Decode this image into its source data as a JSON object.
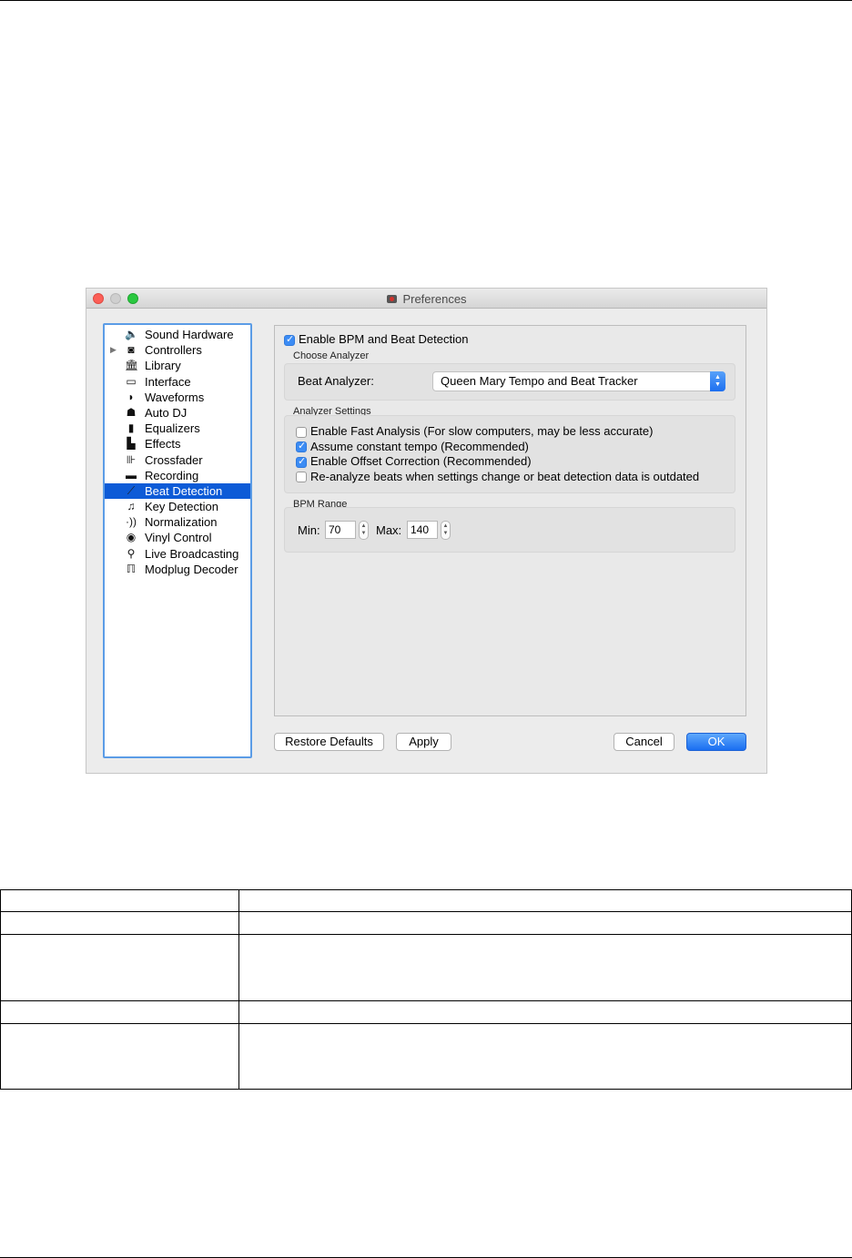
{
  "window": {
    "title": "Preferences"
  },
  "sidebar": {
    "items": [
      {
        "label": "Sound Hardware",
        "icon": "speaker-icon",
        "glyph": "🔈"
      },
      {
        "label": "Controllers",
        "icon": "controller-icon",
        "glyph": "◙"
      },
      {
        "label": "Library",
        "icon": "library-icon",
        "glyph": "🏛"
      },
      {
        "label": "Interface",
        "icon": "monitor-icon",
        "glyph": "▭"
      },
      {
        "label": "Waveforms",
        "icon": "waveforms-icon",
        "glyph": "◗"
      },
      {
        "label": "Auto DJ",
        "icon": "robot-icon",
        "glyph": "☗"
      },
      {
        "label": "Equalizers",
        "icon": "equalizer-icon",
        "glyph": "▮"
      },
      {
        "label": "Effects",
        "icon": "effects-icon",
        "glyph": "▙"
      },
      {
        "label": "Crossfader",
        "icon": "crossfader-icon",
        "glyph": "⊪"
      },
      {
        "label": "Recording",
        "icon": "recording-icon",
        "glyph": "▬"
      },
      {
        "label": "Beat Detection",
        "icon": "beat-detection-icon",
        "glyph": "⟋"
      },
      {
        "label": "Key Detection",
        "icon": "treble-clef-icon",
        "glyph": "♫"
      },
      {
        "label": "Normalization",
        "icon": "normalization-icon",
        "glyph": "·))"
      },
      {
        "label": "Vinyl Control",
        "icon": "vinyl-icon",
        "glyph": "◉"
      },
      {
        "label": "Live Broadcasting",
        "icon": "satellite-dish-icon",
        "glyph": "⚲"
      },
      {
        "label": "Modplug Decoder",
        "icon": "modplug-icon",
        "glyph": "ℿ"
      }
    ],
    "expandable_glyph": "▶",
    "selected": "Beat Detection"
  },
  "panel": {
    "enable_label": "Enable BPM and Beat Detection",
    "enable_checked": true,
    "choose_analyzer": {
      "title": "Choose Analyzer",
      "label": "Beat Analyzer:",
      "selected": "Queen Mary Tempo and Beat Tracker"
    },
    "analyzer_settings": {
      "title": "Analyzer Settings",
      "options": [
        {
          "label": "Enable Fast Analysis (For slow computers, may be less accurate)",
          "checked": false
        },
        {
          "label": "Assume constant tempo (Recommended)",
          "checked": true
        },
        {
          "label": "Enable Offset Correction (Recommended)",
          "checked": true
        },
        {
          "label": "Re-analyze beats when settings change or beat detection data is outdated",
          "checked": false
        }
      ]
    },
    "bpm_range": {
      "title": "BPM Range",
      "min_label": "Min:",
      "min_value": "70",
      "max_label": "Max:",
      "max_value": "140"
    }
  },
  "buttons": {
    "restore_defaults": "Restore Defaults",
    "apply": "Apply",
    "cancel": "Cancel",
    "ok": "OK"
  },
  "colors": {
    "selection": "#0d5bd7",
    "accent": "#3c8cf4",
    "close": "#fc5f57",
    "zoom": "#2ac840"
  }
}
